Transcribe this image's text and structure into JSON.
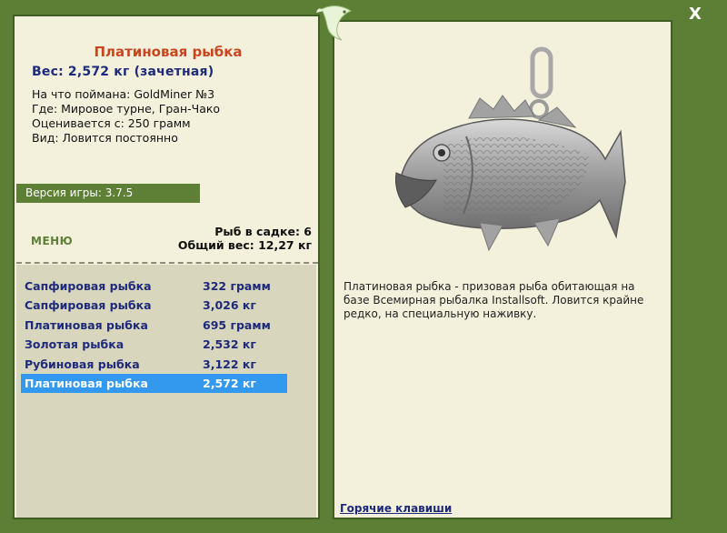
{
  "fish": {
    "title": "Платиновая рыбка",
    "weight_line": "Вес: 2,572 кг (зачетная)",
    "info": [
      "На что поймана: GoldMiner №3",
      "Где: Мировое турне, Гран-Чако",
      "Оценивается с: 250 грамм",
      "Вид: Ловится постоянно"
    ],
    "description": "Платиновая рыбка - призовая рыба обитающая на базе Всемирная рыбалка Installsoft. Ловится крайне редко, на специальную наживку."
  },
  "version": "Версия игры: 3.7.5",
  "menu_label": "МЕНЮ",
  "cage": {
    "count_line": "Рыб в садке: 6",
    "total_line": "Общий вес: 12,27 кг"
  },
  "catches": [
    {
      "name": "Сапфировая рыбка",
      "weight": "322 грамм"
    },
    {
      "name": "Сапфировая рыбка",
      "weight": "3,026 кг"
    },
    {
      "name": "Платиновая рыбка",
      "weight": "695 грамм"
    },
    {
      "name": "Золотая рыбка",
      "weight": "2,532 кг"
    },
    {
      "name": "Рубиновая рыбка",
      "weight": "3,122 кг"
    },
    {
      "name": "Платиновая рыбка",
      "weight": "2,572 кг",
      "selected": true
    }
  ],
  "hotkeys_label": "Горячие клавиши",
  "close_label": "X",
  "colors": {
    "frame_green": "#5d7f36",
    "panel_bg": "#f3f1dc",
    "title_orange": "#c8461f",
    "navy_text": "#1e2a7a",
    "selection_blue": "#3399ee"
  },
  "icons": {
    "close": "close-icon",
    "logo": "fish-logo-icon"
  }
}
